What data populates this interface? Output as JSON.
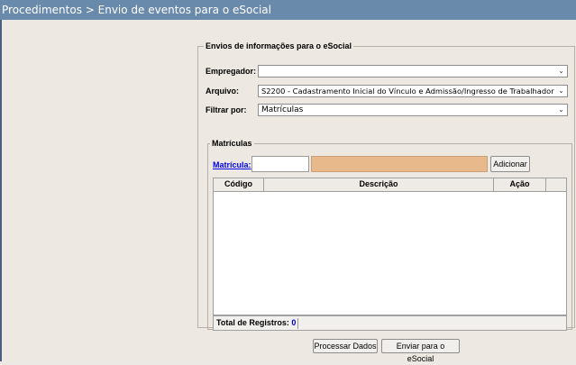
{
  "title": "Procedimentos > Envio de eventos para o eSocial",
  "envios": {
    "legend": "Envios de informações para o eSocial",
    "empregador_label": "Empregador:",
    "empregador_value": "",
    "arquivo_label": "Arquivo:",
    "arquivo_value": "S2200 - Cadastramento Inicial do Vínculo e Admissão/Ingresso de Trabalhador",
    "filtrar_label": "Filtrar por:",
    "filtrar_value": "Matrículas"
  },
  "matriculas": {
    "legend": "Matrículas",
    "link_label": "Matrícula:",
    "input_value": "",
    "add_label": "Adicionar",
    "columns": [
      "Código",
      "Descrição",
      "Ação"
    ],
    "rows": [],
    "total_label": "Total de Registros:",
    "total_value": "0"
  },
  "footer": {
    "process_label": "Processar Dados",
    "send_label": "Enviar para o eSocial"
  },
  "colors": {
    "titlebar": "#6a8aab",
    "background": "#ede8e1",
    "description_field": "#e8b98a",
    "link": "#0000ee"
  }
}
